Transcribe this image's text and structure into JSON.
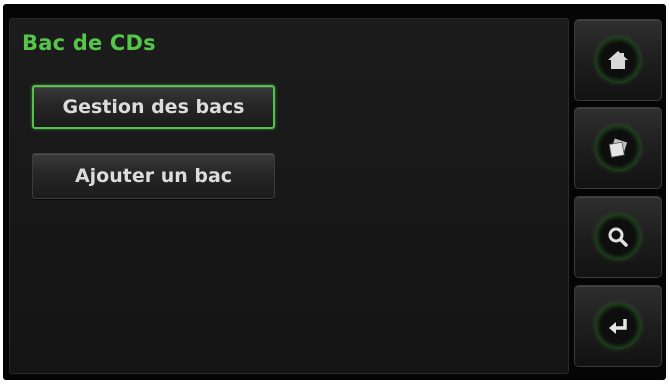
{
  "screen": {
    "title": "Bac de CDs",
    "accent_color": "#55c64a"
  },
  "menu": {
    "items": [
      {
        "label": "Gestion des bacs",
        "selected": true
      },
      {
        "label": "Ajouter un bac",
        "selected": false
      }
    ]
  },
  "sidebar": {
    "buttons": [
      {
        "icon": "home-icon"
      },
      {
        "icon": "discs-icon"
      },
      {
        "icon": "search-icon"
      },
      {
        "icon": "return-icon"
      }
    ]
  }
}
